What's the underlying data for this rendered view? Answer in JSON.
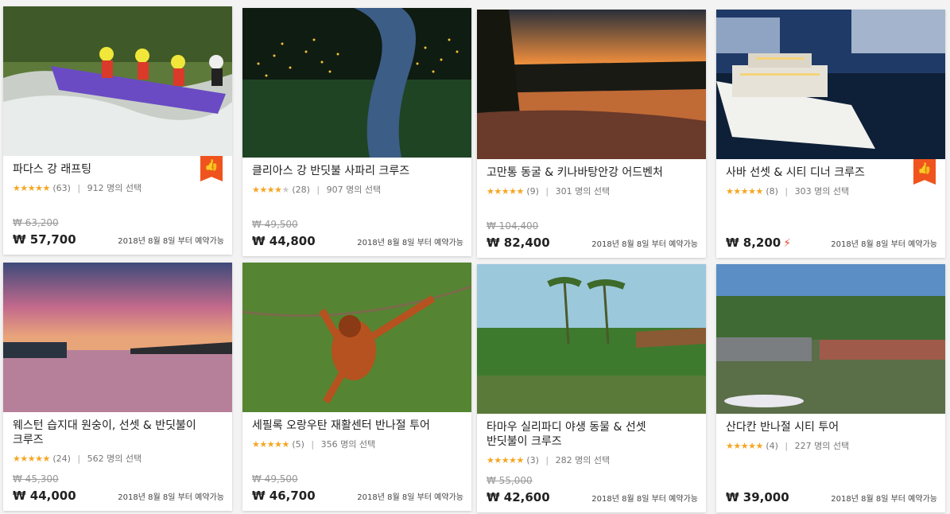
{
  "products": [
    {
      "title": "파다스 강 래프팅",
      "rating": 4.5,
      "reviews": "(63)",
      "chosen": "912 명의 선택",
      "old_price": "₩ 63,200",
      "price": "₩ 57,700",
      "availability": "2018년 8월 8일 부터 예약가능",
      "badge": "thumbs-up-icon",
      "instant": false
    },
    {
      "title": "클리아스 강 반딧불 사파리 크루즈",
      "rating": 4.0,
      "reviews": "(28)",
      "chosen": "907 명의 선택",
      "old_price": "₩ 49,500",
      "price": "₩ 44,800",
      "availability": "2018년 8월 8일 부터 예약가능",
      "badge": null,
      "instant": false
    },
    {
      "title": "고만통 동굴 & 키나바탕안강 어드벤처",
      "rating": 5.0,
      "reviews": "(9)",
      "chosen": "301 명의 선택",
      "old_price": "₩ 104,400",
      "price": "₩ 82,400",
      "availability": "2018년 8월 8일 부터 예약가능",
      "badge": null,
      "instant": false
    },
    {
      "title": "사바 선셋 & 시티 디너 크루즈",
      "rating": 4.5,
      "reviews": "(8)",
      "chosen": "303 명의 선택",
      "old_price": "",
      "price": "₩ 8,200",
      "availability": "2018년 8월 8일 부터 예약가능",
      "badge": "thumbs-up-icon",
      "instant": true
    },
    {
      "title": "웨스턴 습지대 원숭이, 선셋 & 반딧불이 크루즈",
      "rating": 4.5,
      "reviews": "(24)",
      "chosen": "562 명의 선택",
      "old_price": "₩ 45,300",
      "price": "₩ 44,000",
      "availability": "2018년 8월 8일 부터 예약가능",
      "badge": null,
      "instant": false
    },
    {
      "title": "세필록 오랑우탄 재활센터 반나절 투어",
      "rating": 5.0,
      "reviews": "(5)",
      "chosen": "356 명의 선택",
      "old_price": "₩ 49,500",
      "price": "₩ 46,700",
      "availability": "2018년 8월 8일 부터 예약가능",
      "badge": null,
      "instant": false
    },
    {
      "title": "타마우 실리파디 야생 동물 & 선셋 반딧불이 크루즈",
      "rating": 4.5,
      "reviews": "(3)",
      "chosen": "282 명의 선택",
      "old_price": "₩ 55,000",
      "price": "₩ 42,600",
      "availability": "2018년 8월 8일 부터 예약가능",
      "badge": null,
      "instant": false
    },
    {
      "title": "산다칸 반나절 시티 투어",
      "rating": 5.0,
      "reviews": "(4)",
      "chosen": "227 명의 선택",
      "old_price": "",
      "price": "₩ 39,000",
      "availability": "2018년 8월 8일 부터 예약가능",
      "badge": null,
      "instant": false
    }
  ],
  "icons": {
    "badge_glyph": "👍",
    "bolt_glyph": "⚡"
  },
  "colors": {
    "star": "#f5a623",
    "badge": "#f0541e",
    "bolt": "#e74c3c"
  }
}
